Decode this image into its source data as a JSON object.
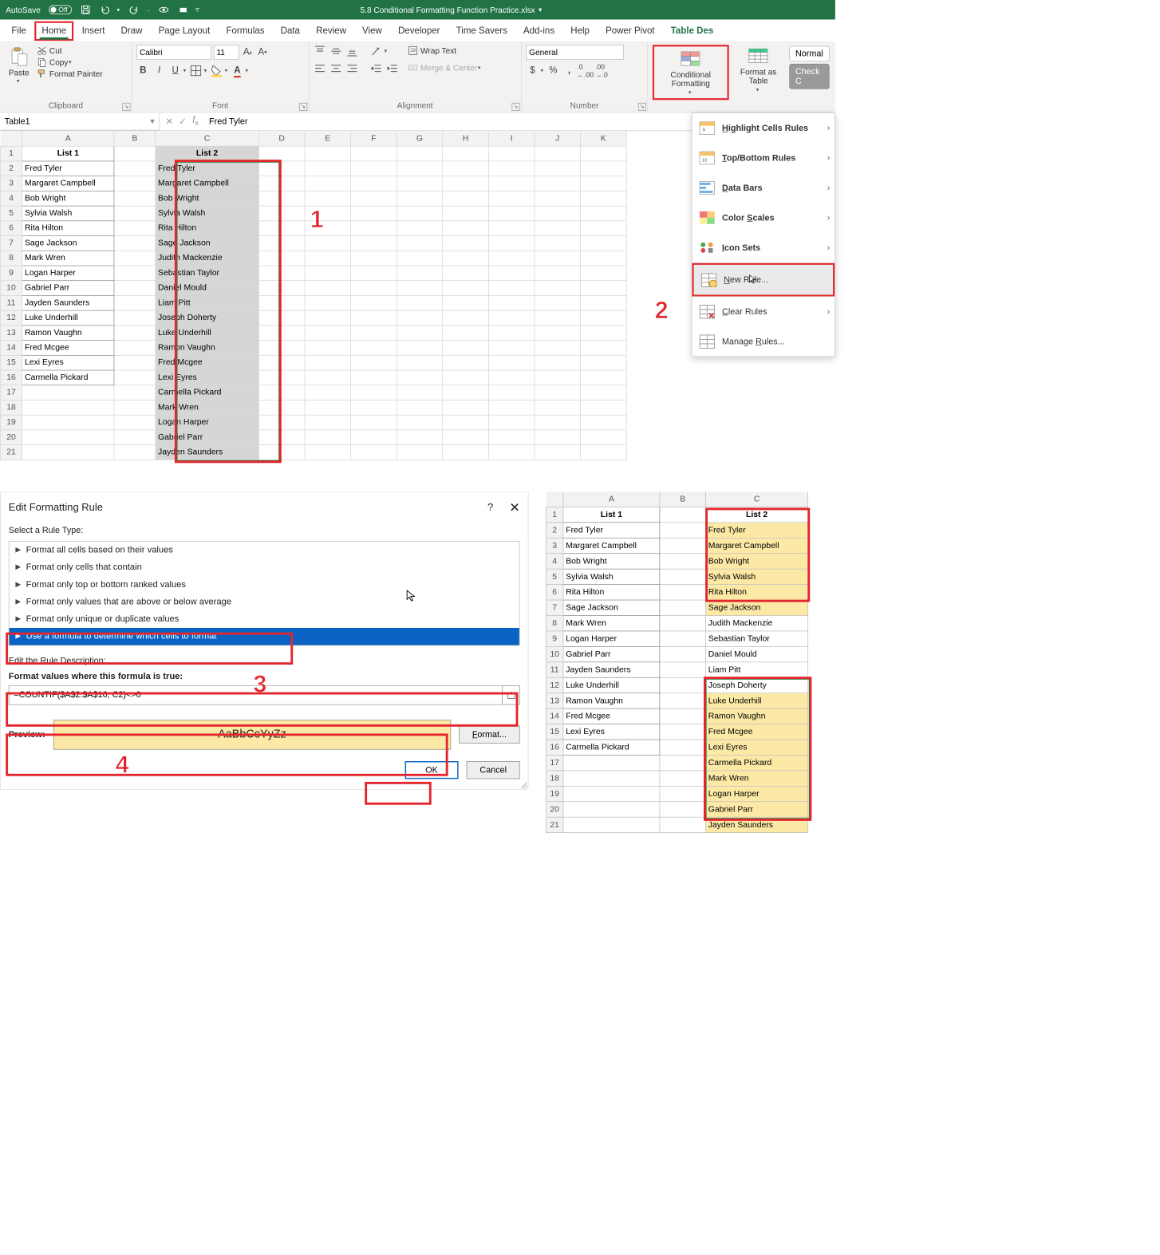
{
  "titlebar": {
    "autosave_label": "AutoSave",
    "autosave_state": "Off",
    "filename": "5.8 Conditional Formatting Function Practice.xlsx"
  },
  "ribbon": {
    "tabs": [
      "File",
      "Home",
      "Insert",
      "Draw",
      "Page Layout",
      "Formulas",
      "Data",
      "Review",
      "View",
      "Developer",
      "Time Savers",
      "Add-ins",
      "Help",
      "Power Pivot",
      "Table Des"
    ],
    "active_tab": "Home",
    "clipboard": {
      "paste": "Paste",
      "cut": "Cut",
      "copy": "Copy",
      "format_painter": "Format Painter",
      "group_label": "Clipboard"
    },
    "font": {
      "name": "Calibri",
      "size": "11",
      "group_label": "Font"
    },
    "alignment": {
      "wrap_text": "Wrap Text",
      "merge_center": "Merge & Center",
      "group_label": "Alignment"
    },
    "number": {
      "format": "General",
      "group_label": "Number"
    },
    "styles": {
      "cond_fmt": "Conditional Formatting",
      "format_as_table": "Format as Table",
      "normal": "Normal",
      "check_cell": "Check C"
    }
  },
  "cf_menu": {
    "highlight": "Highlight Cells Rules",
    "topbottom": "Top/Bottom Rules",
    "databars": "Data Bars",
    "colorscales": "Color Scales",
    "iconsets": "Icon Sets",
    "new_rule": "New Rule...",
    "clear_rules": "Clear Rules",
    "manage_rules": "Manage Rules..."
  },
  "formula_bar": {
    "name_box": "Table1",
    "formula": "Fred Tyler"
  },
  "grid": {
    "columns": [
      "A",
      "B",
      "C",
      "D",
      "E",
      "F",
      "G",
      "H",
      "I",
      "J",
      "K"
    ],
    "headers": {
      "list1": "List 1",
      "list2": "List 2"
    },
    "colA": [
      "Fred Tyler",
      "Margaret Campbell",
      "Bob Wright",
      "Sylvia Walsh",
      "Rita Hilton",
      "Sage Jackson",
      "Mark Wren",
      "Logan Harper",
      "Gabriel Parr",
      "Jayden Saunders",
      "Luke Underhill",
      "Ramon Vaughn",
      "Fred Mcgee",
      "Lexi Eyres",
      "Carmella Pickard"
    ],
    "colC": [
      "Fred Tyler",
      "Margaret Campbell",
      "Bob Wright",
      "Sylvia Walsh",
      "Rita Hilton",
      "Sage Jackson",
      "Judith Mackenzie",
      "Sebastian Taylor",
      "Daniel Mould",
      "Liam Pitt",
      "Joseph Doherty",
      "Luke Underhill",
      "Ramon Vaughn",
      "Fred Mcgee",
      "Lexi Eyres",
      "Carmella Pickard",
      "Mark Wren",
      "Logan Harper",
      "Gabriel Parr",
      "Jayden Saunders"
    ]
  },
  "callouts": {
    "one": "1",
    "two": "2",
    "three": "3",
    "four": "4"
  },
  "dialog": {
    "title": "Edit Formatting Rule",
    "select_label": "Select a Rule Type:",
    "rule_types": [
      "Format all cells based on their values",
      "Format only cells that contain",
      "Format only top or bottom ranked values",
      "Format only values that are above or below average",
      "Format only unique or duplicate values",
      "Use a formula to determine which cells to format"
    ],
    "edit_desc": "Edit the Rule Description:",
    "formula_label": "Format values where this formula is true:",
    "formula": "=COUNTIF($A$2:$A$16, C2)<>0",
    "preview_label": "Preview:",
    "preview_text": "AaBbCcYyZz",
    "format_btn": "Format...",
    "ok": "OK",
    "cancel": "Cancel"
  },
  "result": {
    "columns": [
      "A",
      "B",
      "C"
    ],
    "headers": {
      "list1": "List 1",
      "list2": "List 2"
    },
    "colA": [
      "Fred Tyler",
      "Margaret Campbell",
      "Bob Wright",
      "Sylvia Walsh",
      "Rita Hilton",
      "Sage Jackson",
      "Mark Wren",
      "Logan Harper",
      "Gabriel Parr",
      "Jayden Saunders",
      "Luke Underhill",
      "Ramon Vaughn",
      "Fred Mcgee",
      "Lexi Eyres",
      "Carmella Pickard"
    ],
    "colC": [
      "Fred Tyler",
      "Margaret Campbell",
      "Bob Wright",
      "Sylvia Walsh",
      "Rita Hilton",
      "Sage Jackson",
      "Judith Mackenzie",
      "Sebastian Taylor",
      "Daniel Mould",
      "Liam Pitt",
      "Joseph Doherty",
      "Luke Underhill",
      "Ramon Vaughn",
      "Fred Mcgee",
      "Lexi Eyres",
      "Carmella Pickard",
      "Mark Wren",
      "Logan Harper",
      "Gabriel Parr",
      "Jayden Saunders"
    ],
    "highlighted_rows_C": [
      0,
      1,
      2,
      3,
      4,
      5,
      11,
      12,
      13,
      14,
      15,
      16,
      17,
      18,
      19
    ]
  }
}
